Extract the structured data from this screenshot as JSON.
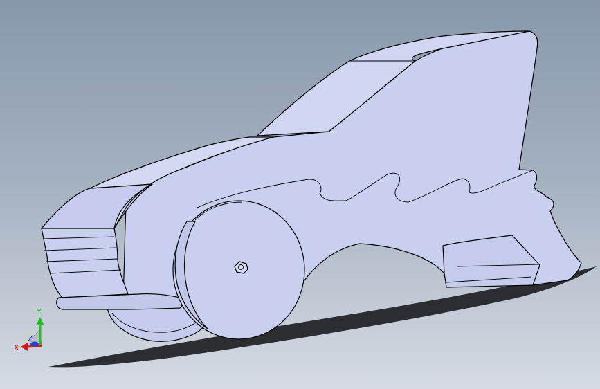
{
  "viewport": {
    "background_top": "#8898ab",
    "background_bottom": "#d6dbe3",
    "model_face_color": "#c9d0ef",
    "model_side_color": "#b9c1e6",
    "edge_color": "#000000",
    "shadow_color": "#1e1f24"
  },
  "triad": {
    "x_label": "X",
    "y_label": "Y",
    "z_label": "Z",
    "x_color": "#e0101a",
    "y_color": "#1fc21f",
    "z_color": "#2a3fd6"
  }
}
